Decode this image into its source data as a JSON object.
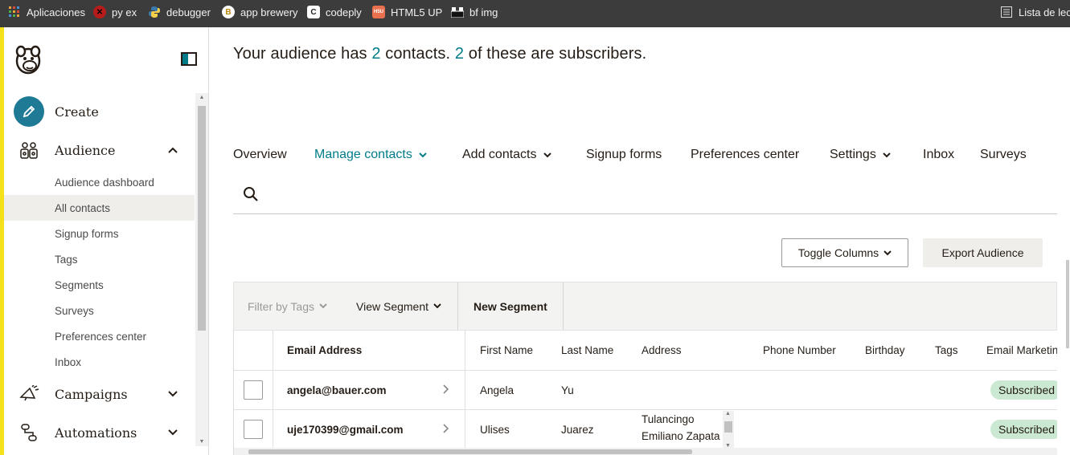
{
  "bookmarks": {
    "items": [
      {
        "label": "Aplicaciones",
        "icon": "apps-grid-icon"
      },
      {
        "label": "py ex",
        "icon": "py-ex-icon"
      },
      {
        "label": "debugger",
        "icon": "python-icon"
      },
      {
        "label": "app brewery",
        "icon": "app-brewery-icon"
      },
      {
        "label": "codeply",
        "icon": "codeply-icon"
      },
      {
        "label": "HTML5 UP",
        "icon": "html5up-icon"
      },
      {
        "label": "bf img",
        "icon": "bf-img-icon"
      }
    ],
    "reading_list": "Lista de lect"
  },
  "sidebar": {
    "create": "Create",
    "audience": "Audience",
    "audience_items": [
      "Audience dashboard",
      "All contacts",
      "Signup forms",
      "Tags",
      "Segments",
      "Surveys",
      "Preferences center",
      "Inbox"
    ],
    "active_item": "All contacts",
    "campaigns": "Campaigns",
    "automations": "Automations"
  },
  "summary": {
    "prefix": "Your audience has",
    "contacts": "2",
    "middle": "contacts.",
    "subscribers": "2",
    "suffix": "of these are subscribers."
  },
  "tabs": [
    {
      "label": "Overview",
      "dropdown": false
    },
    {
      "label": "Manage contacts",
      "dropdown": true,
      "active": true
    },
    {
      "label": "Add contacts",
      "dropdown": true
    },
    {
      "label": "Signup forms",
      "dropdown": false
    },
    {
      "label": "Preferences center",
      "dropdown": false
    },
    {
      "label": "Settings",
      "dropdown": true
    },
    {
      "label": "Inbox",
      "dropdown": false
    },
    {
      "label": "Surveys",
      "dropdown": false
    }
  ],
  "actions": {
    "toggle_columns": "Toggle Columns",
    "export_audience": "Export Audience"
  },
  "filters": {
    "filter_by_tags": "Filter by Tags",
    "view_segment": "View Segment",
    "new_segment": "New Segment"
  },
  "table": {
    "columns": [
      "Email Address",
      "First Name",
      "Last Name",
      "Address",
      "Phone Number",
      "Birthday",
      "Tags",
      "Email Marketin"
    ],
    "rows": [
      {
        "email": "angela@bauer.com",
        "first": "Angela",
        "last": "Yu",
        "address": [],
        "status": "Subscribed"
      },
      {
        "email": "uje170399@gmail.com",
        "first": "Ulises",
        "last": "Juarez",
        "address": [
          "Tulancingo",
          "Emiliano Zapata"
        ],
        "status": "Subscribed"
      }
    ]
  },
  "colors": {
    "accent": "#007c89",
    "sidebar_edge": "#f5e11a",
    "subscribed_badge": "#cbe8d2"
  }
}
